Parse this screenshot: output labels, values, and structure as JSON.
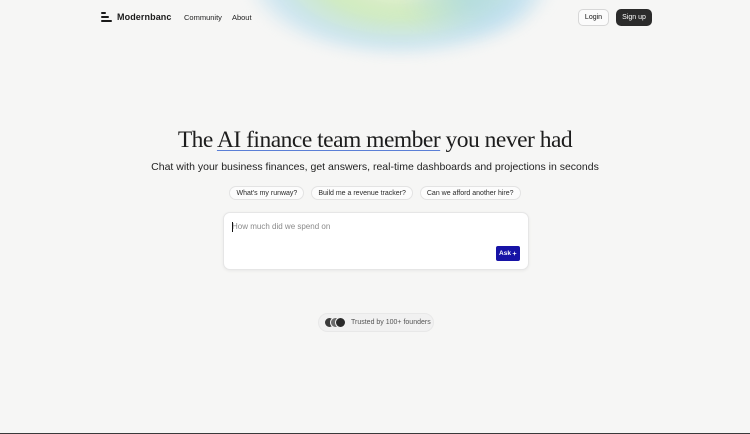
{
  "brand": {
    "name": "Modernbanc",
    "icon": "stacked-bars-logo-icon"
  },
  "nav": {
    "items": [
      "Community",
      "About"
    ]
  },
  "auth": {
    "login_label": "Login",
    "signup_label": "Sign up"
  },
  "hero": {
    "title_before": "The ",
    "title_underlined": "AI finance team member",
    "title_after": " you never had",
    "subtitle": "Chat with your business finances, get answers, real-time dashboards and projections in seconds"
  },
  "suggestions": [
    "What's my runway?",
    "Build me a revenue tracker?",
    "Can we afford another hire?"
  ],
  "ask": {
    "placeholder": "How much did we spend on",
    "button_label": "Ask",
    "button_icon": "sparkle-icon"
  },
  "social_proof": {
    "text": "Trusted by 100+ founders"
  },
  "colors": {
    "accent": "#1713a6",
    "signup_bg": "#2b2b2b",
    "background": "#f6f6f5"
  }
}
